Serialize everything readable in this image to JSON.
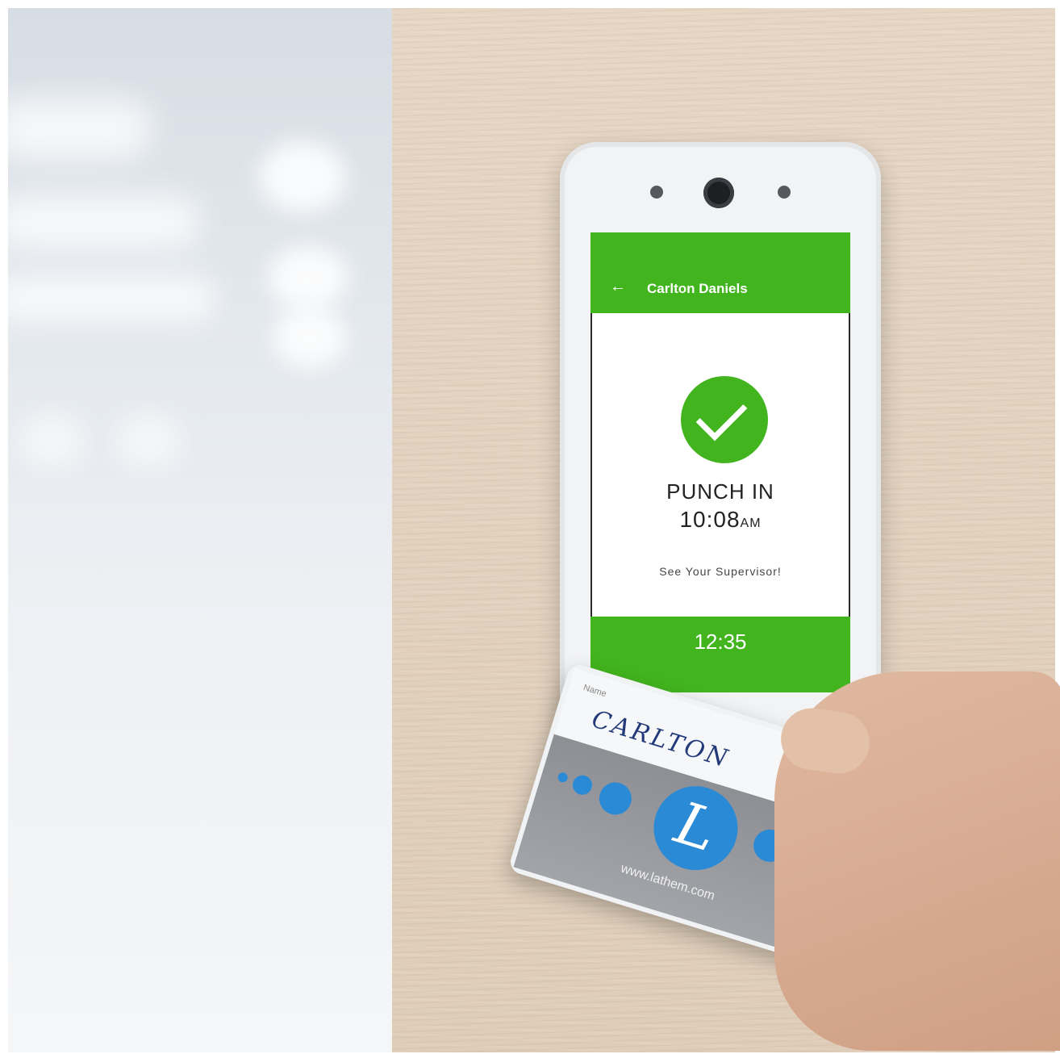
{
  "device": {
    "header": {
      "title": "Carlton Daniels",
      "back_icon": "arrow-left-icon"
    },
    "status": {
      "icon": "check-circle-icon",
      "title": "PUNCH IN",
      "time": "10:08",
      "meridiem": "AM",
      "message": "See Your Supervisor!"
    },
    "footer": {
      "time": "12:35"
    },
    "accent_color": "#42b51e"
  },
  "card": {
    "name_label": "Name",
    "signature": "CARLTON",
    "logo_letter": "L",
    "url": "www.lathem.com",
    "accent_color": "#2b8ad6"
  }
}
